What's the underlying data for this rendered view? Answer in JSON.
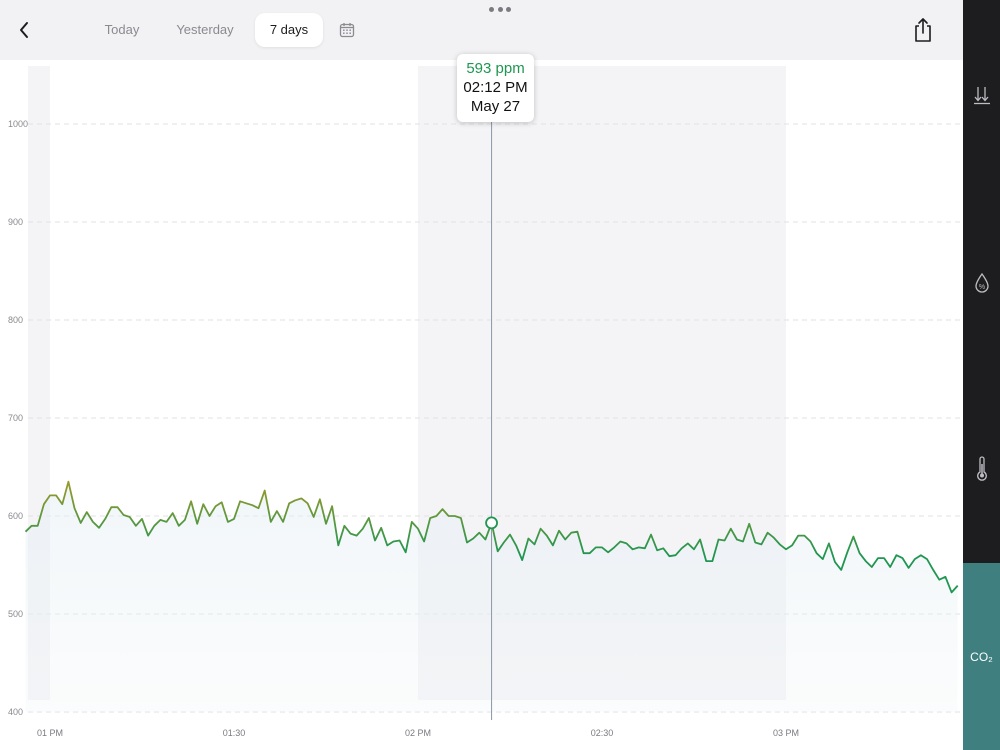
{
  "header": {
    "tabs": [
      {
        "label": "Today",
        "active": false
      },
      {
        "label": "Yesterday",
        "active": false
      },
      {
        "label": "7 days",
        "active": true
      }
    ],
    "icons": {
      "back": "chevron-left-icon",
      "calendar": "calendar-icon",
      "share": "share-icon",
      "handle": "more-dots-icon"
    }
  },
  "tooltip": {
    "value": "593 ppm",
    "time": "02:12 PM",
    "date": "May 27"
  },
  "sidebar": {
    "items": [
      {
        "name": "pressure",
        "icon": "pressure-arrows-icon",
        "label": "",
        "active": false
      },
      {
        "name": "humidity",
        "icon": "humidity-drop-icon",
        "label": "",
        "active": false
      },
      {
        "name": "temperature",
        "icon": "thermometer-icon",
        "label": "",
        "active": false
      },
      {
        "name": "co2",
        "icon": "co2-icon",
        "label": "CO₂",
        "active": true
      }
    ]
  },
  "colors": {
    "line_green": "#1f9651",
    "line_olive": "#a39a28",
    "accent_teal": "#3f7f80",
    "sidebar_bg": "#1d1d1f"
  },
  "chart_data": {
    "type": "line",
    "title": "",
    "xlabel": "",
    "ylabel": "",
    "unit": "ppm",
    "ylim": [
      400,
      1000
    ],
    "yticks": [
      400,
      500,
      600,
      700,
      800,
      900,
      1000
    ],
    "x_range": [
      "12:55 PM",
      "3:35 PM"
    ],
    "xticks": [
      {
        "time": "1:00 PM",
        "label": "01 PM"
      },
      {
        "time": "1:30 PM",
        "label": "01:30"
      },
      {
        "time": "2:00 PM",
        "label": "02 PM"
      },
      {
        "time": "2:30 PM",
        "label": "02:30"
      },
      {
        "time": "3:00 PM",
        "label": "03 PM"
      }
    ],
    "grid": true,
    "selected_point": {
      "time": "2:12 PM",
      "value": 593
    },
    "series": [
      {
        "name": "",
        "points": [
          [
            "12:56 PM",
            584
          ],
          [
            "12:57 PM",
            590
          ],
          [
            "12:58 PM",
            590
          ],
          [
            "12:59 PM",
            612
          ],
          [
            "1:00 PM",
            621
          ],
          [
            "1:01 PM",
            621
          ],
          [
            "1:02 PM",
            612
          ],
          [
            "1:03 PM",
            635
          ],
          [
            "1:04 PM",
            608
          ],
          [
            "1:05 PM",
            593
          ],
          [
            "1:06 PM",
            604
          ],
          [
            "1:07 PM",
            594
          ],
          [
            "1:08 PM",
            588
          ],
          [
            "1:09 PM",
            597
          ],
          [
            "1:10 PM",
            609
          ],
          [
            "1:11 PM",
            609
          ],
          [
            "1:12 PM",
            601
          ],
          [
            "1:13 PM",
            599
          ],
          [
            "1:14 PM",
            590
          ],
          [
            "1:15 PM",
            597
          ],
          [
            "1:16 PM",
            580
          ],
          [
            "1:17 PM",
            590
          ],
          [
            "1:18 PM",
            596
          ],
          [
            "1:19 PM",
            594
          ],
          [
            "1:20 PM",
            603
          ],
          [
            "1:21 PM",
            590
          ],
          [
            "1:22 PM",
            596
          ],
          [
            "1:23 PM",
            615
          ],
          [
            "1:24 PM",
            592
          ],
          [
            "1:25 PM",
            612
          ],
          [
            "1:26 PM",
            600
          ],
          [
            "1:27 PM",
            610
          ],
          [
            "1:28 PM",
            614
          ],
          [
            "1:29 PM",
            594
          ],
          [
            "1:30 PM",
            597
          ],
          [
            "1:31 PM",
            615
          ],
          [
            "1:32 PM",
            613
          ],
          [
            "1:33 PM",
            611
          ],
          [
            "1:34 PM",
            608
          ],
          [
            "1:35 PM",
            626
          ],
          [
            "1:36 PM",
            594
          ],
          [
            "1:37 PM",
            605
          ],
          [
            "1:38 PM",
            594
          ],
          [
            "1:39 PM",
            613
          ],
          [
            "1:40 PM",
            616
          ],
          [
            "1:41 PM",
            618
          ],
          [
            "1:42 PM",
            613
          ],
          [
            "1:43 PM",
            599
          ],
          [
            "1:44 PM",
            617
          ],
          [
            "1:45 PM",
            592
          ],
          [
            "1:46 PM",
            610
          ],
          [
            "1:47 PM",
            570
          ],
          [
            "1:48 PM",
            590
          ],
          [
            "1:49 PM",
            582
          ],
          [
            "1:50 PM",
            580
          ],
          [
            "1:51 PM",
            587
          ],
          [
            "1:52 PM",
            598
          ],
          [
            "1:53 PM",
            575
          ],
          [
            "1:54 PM",
            588
          ],
          [
            "1:55 PM",
            570
          ],
          [
            "1:56 PM",
            574
          ],
          [
            "1:57 PM",
            575
          ],
          [
            "1:58 PM",
            563
          ],
          [
            "1:59 PM",
            594
          ],
          [
            "2:00 PM",
            587
          ],
          [
            "2:01 PM",
            574
          ],
          [
            "2:02 PM",
            598
          ],
          [
            "2:03 PM",
            600
          ],
          [
            "2:04 PM",
            607
          ],
          [
            "2:05 PM",
            600
          ],
          [
            "2:06 PM",
            600
          ],
          [
            "2:07 PM",
            598
          ],
          [
            "2:08 PM",
            573
          ],
          [
            "2:09 PM",
            577
          ],
          [
            "2:10 PM",
            583
          ],
          [
            "2:11 PM",
            576
          ],
          [
            "2:12 PM",
            593
          ],
          [
            "2:13 PM",
            564
          ],
          [
            "2:14 PM",
            573
          ],
          [
            "2:15 PM",
            581
          ],
          [
            "2:16 PM",
            570
          ],
          [
            "2:17 PM",
            555
          ],
          [
            "2:18 PM",
            577
          ],
          [
            "2:19 PM",
            571
          ],
          [
            "2:20 PM",
            587
          ],
          [
            "2:21 PM",
            580
          ],
          [
            "2:22 PM",
            570
          ],
          [
            "2:23 PM",
            585
          ],
          [
            "2:24 PM",
            576
          ],
          [
            "2:25 PM",
            583
          ],
          [
            "2:26 PM",
            584
          ],
          [
            "2:27 PM",
            562
          ],
          [
            "2:28 PM",
            562
          ],
          [
            "2:29 PM",
            568
          ],
          [
            "2:30 PM",
            568
          ],
          [
            "2:31 PM",
            563
          ],
          [
            "2:32 PM",
            568
          ],
          [
            "2:33 PM",
            574
          ],
          [
            "2:34 PM",
            572
          ],
          [
            "2:35 PM",
            566
          ],
          [
            "2:36 PM",
            568
          ],
          [
            "2:37 PM",
            567
          ],
          [
            "2:38 PM",
            581
          ],
          [
            "2:39 PM",
            565
          ],
          [
            "2:40 PM",
            567
          ],
          [
            "2:41 PM",
            559
          ],
          [
            "2:42 PM",
            560
          ],
          [
            "2:43 PM",
            567
          ],
          [
            "2:44 PM",
            572
          ],
          [
            "2:45 PM",
            566
          ],
          [
            "2:46 PM",
            576
          ],
          [
            "2:47 PM",
            554
          ],
          [
            "2:48 PM",
            554
          ],
          [
            "2:49 PM",
            576
          ],
          [
            "2:50 PM",
            575
          ],
          [
            "2:51 PM",
            587
          ],
          [
            "2:52 PM",
            576
          ],
          [
            "2:53 PM",
            574
          ],
          [
            "2:54 PM",
            592
          ],
          [
            "2:55 PM",
            573
          ],
          [
            "2:56 PM",
            571
          ],
          [
            "2:57 PM",
            583
          ],
          [
            "2:58 PM",
            578
          ],
          [
            "2:59 PM",
            571
          ],
          [
            "3:00 PM",
            566
          ],
          [
            "3:01 PM",
            570
          ],
          [
            "3:02 PM",
            580
          ],
          [
            "3:03 PM",
            580
          ],
          [
            "3:04 PM",
            574
          ],
          [
            "3:05 PM",
            562
          ],
          [
            "3:06 PM",
            556
          ],
          [
            "3:07 PM",
            572
          ],
          [
            "3:08 PM",
            553
          ],
          [
            "3:09 PM",
            545
          ],
          [
            "3:10 PM",
            563
          ],
          [
            "3:11 PM",
            579
          ],
          [
            "3:12 PM",
            562
          ],
          [
            "3:13 PM",
            554
          ],
          [
            "3:14 PM",
            548
          ],
          [
            "3:15 PM",
            557
          ],
          [
            "3:16 PM",
            557
          ],
          [
            "3:17 PM",
            548
          ],
          [
            "3:18 PM",
            560
          ],
          [
            "3:19 PM",
            557
          ],
          [
            "3:20 PM",
            547
          ],
          [
            "3:21 PM",
            556
          ],
          [
            "3:22 PM",
            560
          ],
          [
            "3:23 PM",
            556
          ],
          [
            "3:24 PM",
            545
          ],
          [
            "3:25 PM",
            535
          ],
          [
            "3:26 PM",
            538
          ],
          [
            "3:27 PM",
            522
          ],
          [
            "3:28 PM",
            529
          ]
        ]
      }
    ]
  }
}
